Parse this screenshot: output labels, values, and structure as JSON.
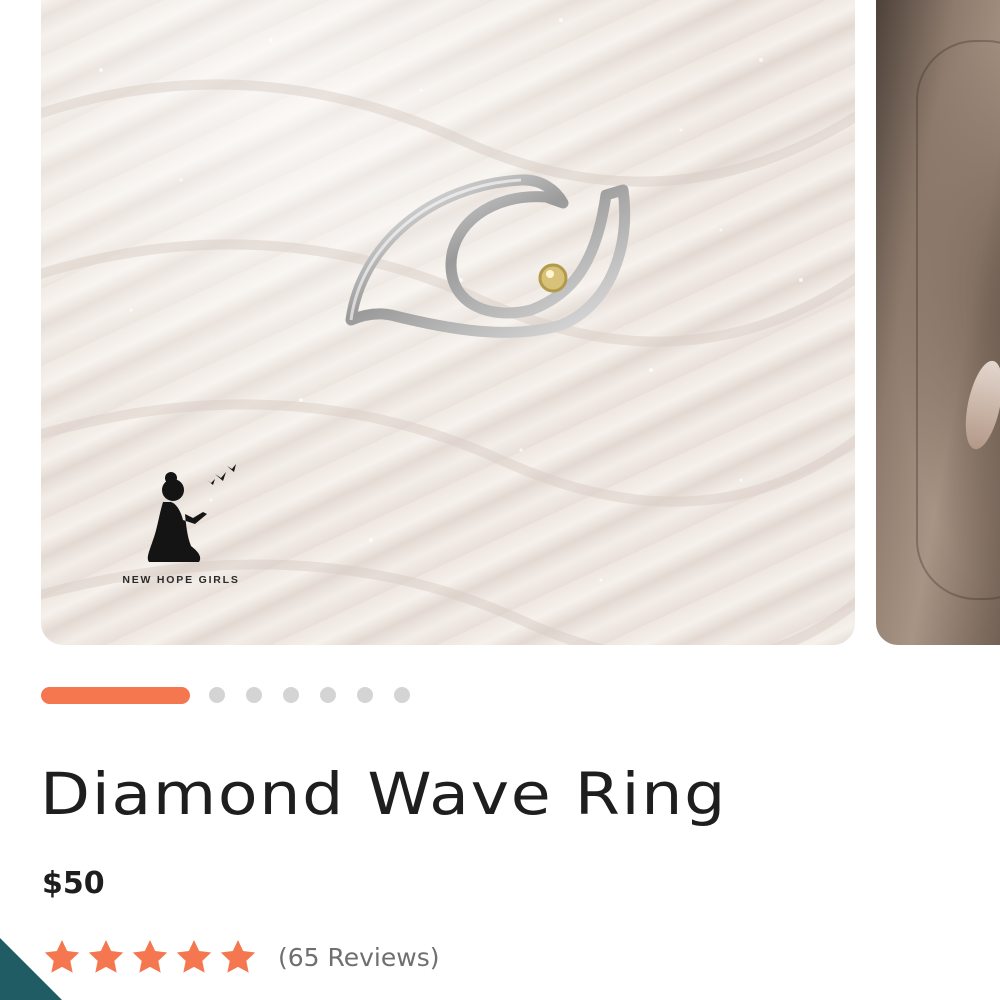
{
  "carousel": {
    "main_image_alt": "Silver wave ring with yellow stone resting in white sand",
    "next_image_alt": "Ring worn on hand",
    "watermark": {
      "brand": "NEW HOPE GIRLS",
      "icon": "kneeling-girl-birds-icon"
    },
    "pager": {
      "count": 7,
      "active_index": 0
    }
  },
  "product": {
    "title": "Diamond Wave Ring",
    "price": "$50",
    "rating": {
      "stars": 5,
      "max": 5,
      "reviews_label": "(65 Reviews)"
    }
  },
  "colors": {
    "accent": "#f4774f",
    "star": "#f4774f",
    "dot_inactive": "#d4d4d4",
    "text": "#1e1e1e",
    "muted": "#6f6f6f",
    "corner": "#1f5c63"
  }
}
